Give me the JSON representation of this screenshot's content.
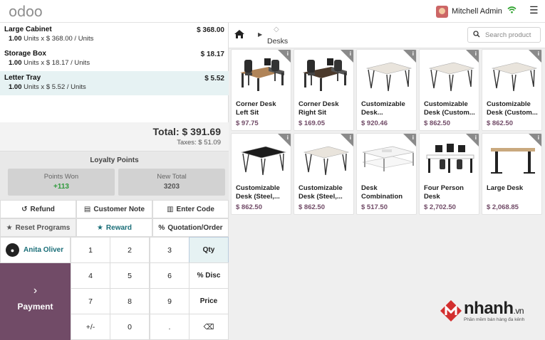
{
  "topbar": {
    "logo": "odoo",
    "user_name": "Mitchell Admin"
  },
  "order": {
    "lines": [
      {
        "name": "Large Cabinet",
        "price": "$ 368.00",
        "qty": "1.00",
        "detail": "Units x $ 368.00 / Units",
        "selected": false
      },
      {
        "name": "Storage Box",
        "price": "$ 18.17",
        "qty": "1.00",
        "detail": "Units x $ 18.17 / Units",
        "selected": false
      },
      {
        "name": "Letter Tray",
        "price": "$ 5.52",
        "qty": "1.00",
        "detail": "Units x $ 5.52 / Units",
        "selected": true
      }
    ],
    "total": "Total: $ 391.69",
    "taxes": "Taxes: $ 51.09"
  },
  "loyalty": {
    "title": "Loyalty Points",
    "won_label": "Points Won",
    "won_value": "+113",
    "total_label": "New Total",
    "total_value": "3203"
  },
  "controls": {
    "refund": "Refund",
    "customer_note": "Customer Note",
    "enter_code": "Enter Code",
    "reset_programs": "Reset Programs",
    "reward": "Reward",
    "quotation_order": "Quotation/Order"
  },
  "customer": {
    "name": "Anita Oliver"
  },
  "payment": {
    "label": "Payment"
  },
  "numpad": {
    "keys": [
      "1",
      "2",
      "3",
      "Qty",
      "4",
      "5",
      "6",
      "% Disc",
      "7",
      "8",
      "9",
      "Price",
      "+/-",
      "0",
      ".",
      "⌫"
    ],
    "active_mode": "Qty"
  },
  "breadcrumb": {
    "category": "Desks"
  },
  "search": {
    "placeholder": "Search product"
  },
  "products": [
    {
      "name": "Corner Desk Left Sit",
      "price": "$ 97.75",
      "image": "corner-desk-left"
    },
    {
      "name": "Corner Desk Right Sit",
      "price": "$ 169.05",
      "image": "corner-desk-right"
    },
    {
      "name": "Customizable Desk...",
      "price": "$ 920.46",
      "image": "white-desk"
    },
    {
      "name": "Customizable Desk (Custom...",
      "price": "$ 862.50",
      "image": "white-desk"
    },
    {
      "name": "Customizable Desk (Custom...",
      "price": "$ 862.50",
      "image": "white-desk"
    },
    {
      "name": "Customizable Desk (Steel,...",
      "price": "$ 862.50",
      "image": "black-desk"
    },
    {
      "name": "Customizable Desk (Steel,...",
      "price": "$ 862.50",
      "image": "white-desk"
    },
    {
      "name": "Desk Combination",
      "price": "$ 517.50",
      "image": "desk-combination"
    },
    {
      "name": "Four Person Desk",
      "price": "$ 2,702.50",
      "image": "four-person-desk"
    },
    {
      "name": "Large Desk",
      "price": "$ 2,068.85",
      "image": "large-desk"
    }
  ],
  "watermark": {
    "brand": "nhanh",
    "tld": ".vn",
    "tagline": "Phần mềm bán hàng đa kênh"
  },
  "colors": {
    "brand": "#714b67",
    "teal": "#1a6e78",
    "selection": "#e6f2f3"
  }
}
